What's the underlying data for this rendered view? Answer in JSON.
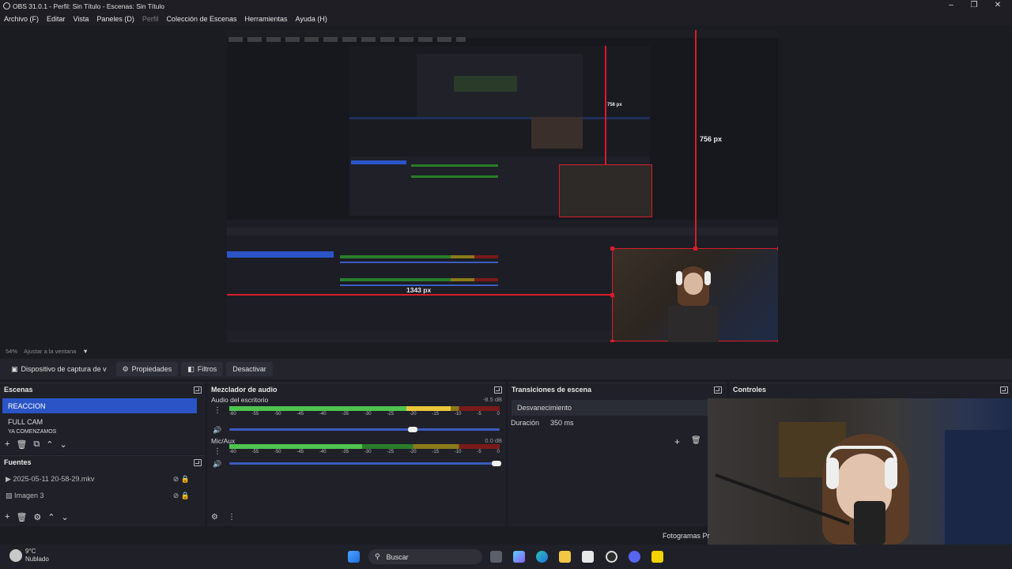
{
  "window": {
    "title": "OBS 31.0.1 - Perfil: Sin Título - Escenas: Sin Título"
  },
  "menu": [
    "Archivo (F)",
    "Editar",
    "Vista",
    "Paneles (D)",
    "Perfil",
    "Colección de Escenas",
    "Herramientas",
    "Ayuda (H)"
  ],
  "preview": {
    "height_label": "756 px",
    "width_label": "1343 px",
    "nested_height_label": "756 px"
  },
  "zoom": {
    "percent": "54%",
    "mode": "Ajustar a la ventana"
  },
  "source_toolbar": {
    "device": "Dispositivo de captura de v",
    "properties": "Propiedades",
    "filters": "Filtros",
    "deactivate": "Desactivar"
  },
  "scenes": {
    "title": "Escenas",
    "items": [
      "REACCION",
      "FULL CAM",
      "YA COMENZAMOS"
    ],
    "selected": 0
  },
  "sources": {
    "title": "Fuentes",
    "items": [
      "2025-05-11 20-58-29.mkv",
      "Imagen 3"
    ]
  },
  "mixer": {
    "title": "Mezclador de audio",
    "channels": [
      {
        "name": "Audio del escritorio",
        "db": "-8.5 dB",
        "level": 0.82,
        "volume": 0.68
      },
      {
        "name": "Mic/Aux",
        "db": "0.0 dB",
        "level": 0.49,
        "volume": 1.0
      }
    ],
    "ticks": [
      "-60",
      "-55",
      "-50",
      "-45",
      "-40",
      "-35",
      "-30",
      "-25",
      "-20",
      "-15",
      "-10",
      "-5",
      "0"
    ]
  },
  "transitions": {
    "title": "Transiciones de escena",
    "selected": "Desvanecimiento",
    "duration_label": "Duración",
    "duration_value": "350 ms"
  },
  "controls": {
    "title": "Controles",
    "fps_label": "Fotogramas Pr"
  },
  "taskbar": {
    "weather_temp": "9°C",
    "weather_desc": "Nublado",
    "search": "Buscar"
  }
}
